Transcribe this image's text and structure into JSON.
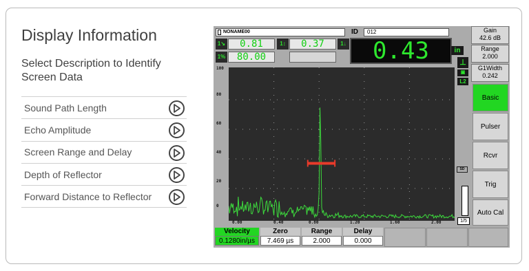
{
  "page": {
    "title": "Display Information",
    "subtitle": "Select Description to Identify Screen Data"
  },
  "menu": [
    {
      "label": "Sound Path Length"
    },
    {
      "label": "Echo Amplitude"
    },
    {
      "label": "Screen Range and Delay"
    },
    {
      "label": "Depth of Reflector"
    },
    {
      "label": "Forward Distance to Reflector"
    }
  ],
  "screen": {
    "file_name": "NONAME00",
    "id_label": "ID",
    "id_value": "012",
    "readings": {
      "r1_icon": "1↘",
      "r1_value": "0.81",
      "r2_icon": "1↕",
      "r2_value": "0.37",
      "r3_icon": "1↓",
      "r4_icon": "1%",
      "r4_value": "80.00",
      "big_value": "0.43",
      "unit": "in",
      "zoom_icon": "L2"
    },
    "gain_label": "Gain",
    "gain_value": "42.6 dB",
    "range_label": "Range",
    "range_value": "2.000",
    "g1width_label": "G1Width",
    "g1width_value": "0.242",
    "menu_buttons": [
      "Basic",
      "Pulser",
      "Rcvr",
      "Trig",
      "Auto Cal"
    ],
    "page_indicator": "1/5",
    "sd_label": "SD",
    "y_ticks": [
      "100",
      "80",
      "60",
      "40",
      "20",
      "0"
    ],
    "x_ticks": [
      "0.00",
      "0.40",
      "0.80",
      "1.20",
      "1.60",
      "2.00"
    ],
    "params": [
      {
        "name": "Velocity",
        "value": "0.1280in/µs"
      },
      {
        "name": "Zero",
        "value": "7.469 µs"
      },
      {
        "name": "Range",
        "value": "2.000"
      },
      {
        "name": "Delay",
        "value": "0.000"
      }
    ],
    "colors": {
      "trace": "#3ddc3d",
      "gate": "#e83a2a",
      "active": "#22d622"
    }
  },
  "chart_data": {
    "type": "line",
    "xlim": [
      0,
      2.0
    ],
    "ylim": [
      0,
      100
    ],
    "grid": true,
    "peak": {
      "x": 0.81,
      "y": 80
    },
    "gate": {
      "start": 0.7,
      "end": 0.94,
      "level": 37
    }
  }
}
